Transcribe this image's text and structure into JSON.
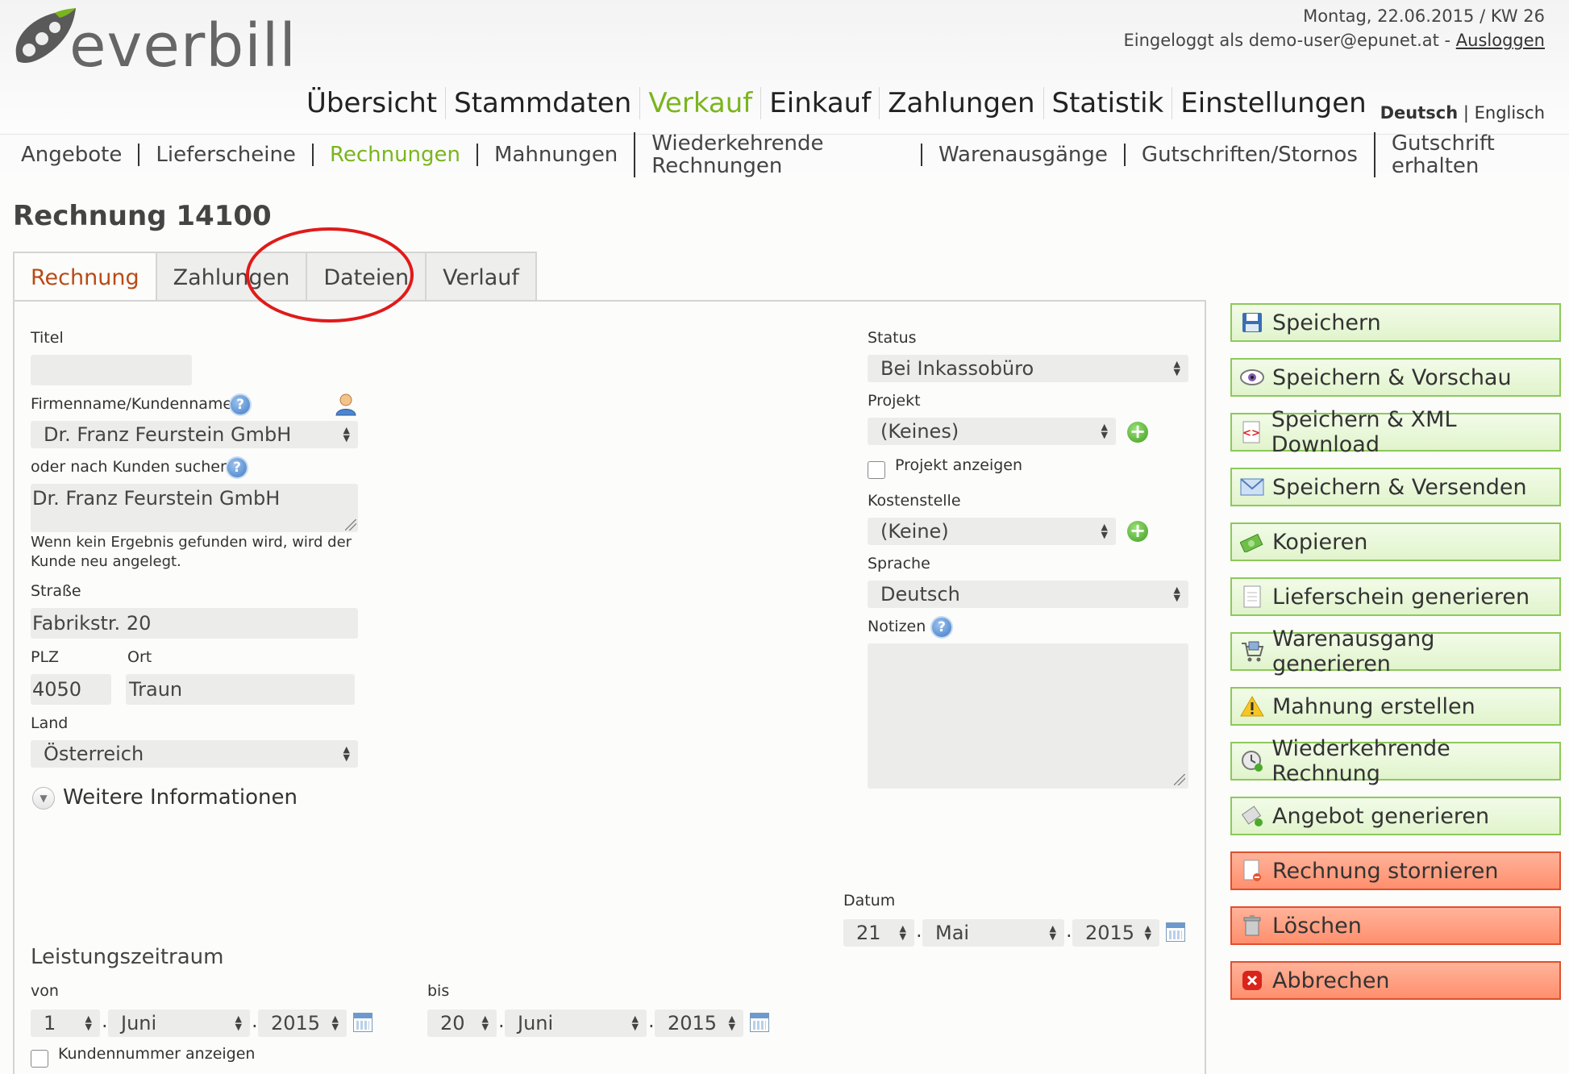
{
  "header": {
    "logo_text": "everbill",
    "date_line": "Montag, 22.06.2015 / KW 26",
    "login_prefix": "Eingeloggt als demo-user@epunet.at -",
    "logout_label": "Ausloggen",
    "lang_active": "Deutsch",
    "lang_sep": "|",
    "lang_other": "Englisch"
  },
  "main_nav": [
    {
      "label": "Übersicht",
      "active": false
    },
    {
      "label": "Stammdaten",
      "active": false
    },
    {
      "label": "Verkauf",
      "active": true
    },
    {
      "label": "Einkauf",
      "active": false
    },
    {
      "label": "Zahlungen",
      "active": false
    },
    {
      "label": "Statistik",
      "active": false
    },
    {
      "label": "Einstellungen",
      "active": false
    }
  ],
  "sub_nav": [
    {
      "label": "Angebote",
      "active": false
    },
    {
      "label": "Lieferscheine",
      "active": false
    },
    {
      "label": "Rechnungen",
      "active": true
    },
    {
      "label": "Mahnungen",
      "active": false
    },
    {
      "label": "Wiederkehrende Rechnungen",
      "active": false
    },
    {
      "label": "Warenausgänge",
      "active": false
    },
    {
      "label": "Gutschriften/Stornos",
      "active": false
    },
    {
      "label": "Gutschrift erhalten",
      "active": false
    }
  ],
  "page_title": "Rechnung 14100",
  "tabs": [
    {
      "label": "Rechnung",
      "active": true
    },
    {
      "label": "Zahlungen",
      "active": false
    },
    {
      "label": "Dateien",
      "active": false
    },
    {
      "label": "Verlauf",
      "active": false
    }
  ],
  "form": {
    "titel_label": "Titel",
    "titel_value": "",
    "firma_label": "Firmenname/Kundenname",
    "firma_value": "Dr. Franz Feurstein GmbH",
    "suche_label": "oder nach Kunden suchen",
    "suche_value": "Dr. Franz Feurstein GmbH",
    "suche_hint_1": "Wenn kein Ergebnis gefunden wird, wird der",
    "suche_hint_2": "Kunde neu angelegt.",
    "strasse_label": "Straße",
    "strasse_value": "Fabrikstr. 20",
    "plz_label": "PLZ",
    "plz_value": "4050",
    "ort_label": "Ort",
    "ort_value": "Traun",
    "land_label": "Land",
    "land_value": "Österreich",
    "weitere_label": "Weitere Informationen",
    "status_label": "Status",
    "status_value": "Bei Inkassobüro",
    "projekt_label": "Projekt",
    "projekt_value": "(Keines)",
    "projekt_anzeigen_label": "Projekt anzeigen",
    "kostenstelle_label": "Kostenstelle",
    "kostenstelle_value": "(Keine)",
    "sprache_label": "Sprache",
    "sprache_value": "Deutsch",
    "notizen_label": "Notizen",
    "notizen_value": "",
    "datum_label": "Datum",
    "datum_day": "21",
    "datum_month": "Mai",
    "datum_year": "2015",
    "leistung_label": "Leistungszeitraum",
    "von_label": "von",
    "von_day": "1",
    "von_month": "Juni",
    "von_year": "2015",
    "bis_label": "bis",
    "bis_day": "20",
    "bis_month": "Juni",
    "bis_year": "2015",
    "kundennummer_label": "Kundennummer anzeigen",
    "date_sep": "."
  },
  "actions": [
    {
      "label": "Speichern",
      "style": "green",
      "icon": "floppy-disk-icon"
    },
    {
      "label": "Speichern & Vorschau",
      "style": "green",
      "icon": "eye-icon"
    },
    {
      "label": "Speichern & XML Download",
      "style": "green",
      "icon": "xml-code-icon"
    },
    {
      "label": "Speichern & Versenden",
      "style": "green",
      "icon": "envelope-icon"
    },
    {
      "label": "Kopieren",
      "style": "green",
      "icon": "money-copy-icon"
    },
    {
      "label": "Lieferschein generieren",
      "style": "green",
      "icon": "document-icon"
    },
    {
      "label": "Warenausgang generieren",
      "style": "green",
      "icon": "cart-icon"
    },
    {
      "label": "Mahnung erstellen",
      "style": "green",
      "icon": "warning-icon"
    },
    {
      "label": "Wiederkehrende Rechnung",
      "style": "green",
      "icon": "recurring-icon"
    },
    {
      "label": "Angebot generieren",
      "style": "green",
      "icon": "offer-icon"
    },
    {
      "label": "Rechnung stornieren",
      "style": "red",
      "icon": "cancel-document-icon"
    },
    {
      "label": "Löschen",
      "style": "red",
      "icon": "trash-icon"
    },
    {
      "label": "Abbrechen",
      "style": "red",
      "icon": "close-icon"
    }
  ],
  "colors": {
    "brand_green": "#7ab51d",
    "active_tab": "#b84a16",
    "annotation_red": "#e01a1a"
  }
}
